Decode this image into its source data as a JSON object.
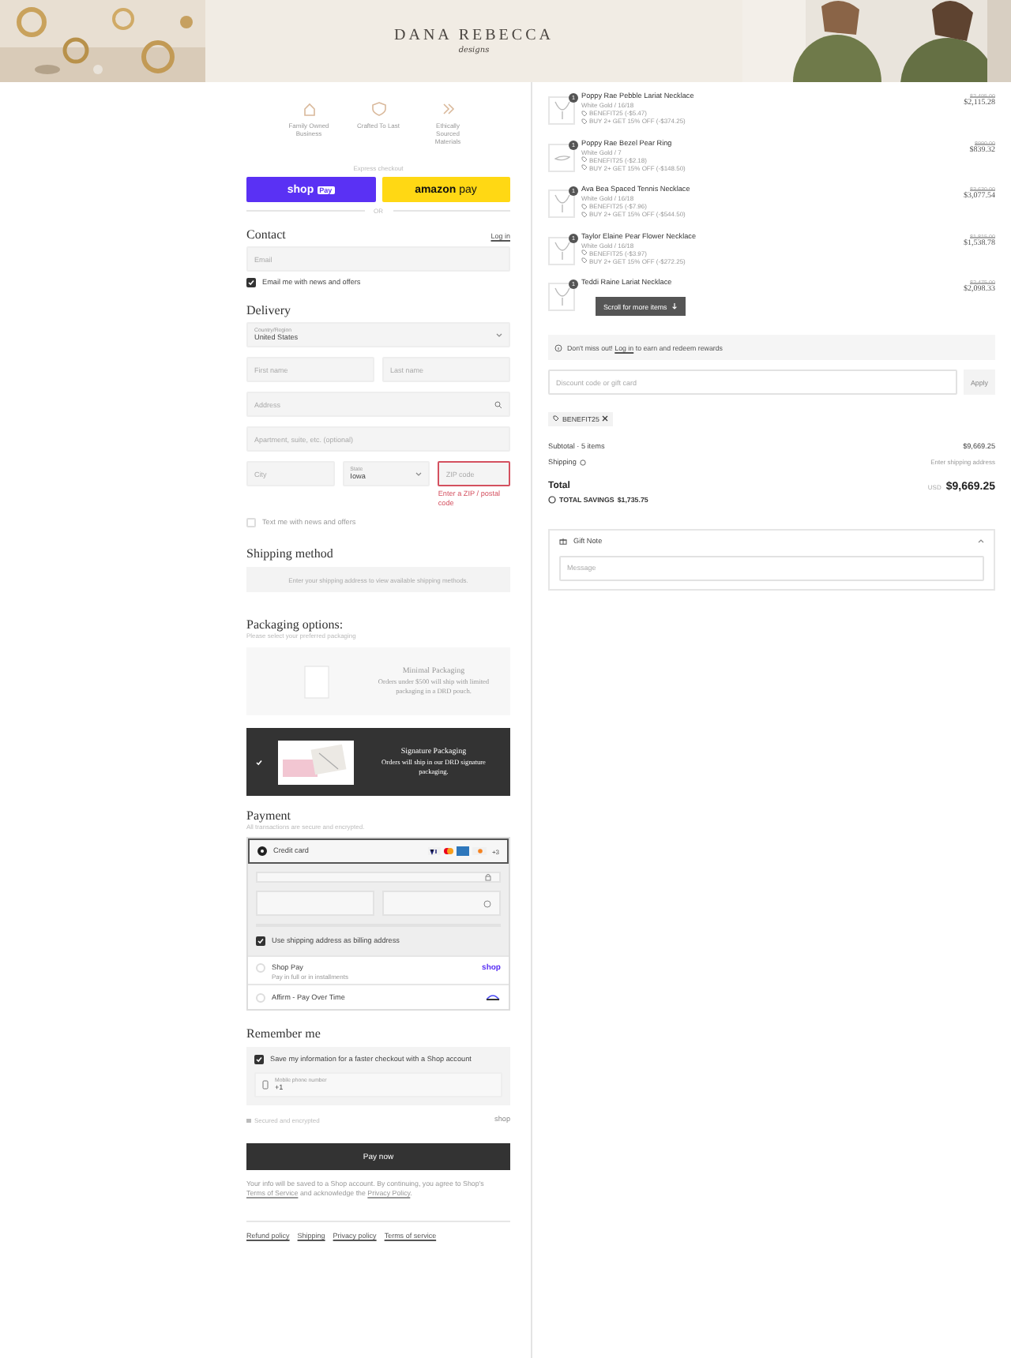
{
  "header": {
    "logo": "DANA REBECCA",
    "logo_sub": "designs"
  },
  "trust": [
    {
      "label": "Family Owned Business"
    },
    {
      "label": "Crafted To Last"
    },
    {
      "label": "Ethically Sourced Materials"
    }
  ],
  "express": {
    "label": "Express checkout",
    "buttons": [
      {
        "kind": "shop",
        "text": "shop",
        "badge": "Pay"
      },
      {
        "kind": "amazon",
        "text": "amazon",
        "suffix": "pay"
      }
    ],
    "or": "OR"
  },
  "contact": {
    "title": "Contact",
    "login": "Log in",
    "email": {
      "placeholder": "Email"
    },
    "news": {
      "label": "Email me with news and offers",
      "checked": true
    }
  },
  "delivery": {
    "title": "Delivery",
    "country": {
      "label": "Country/Region",
      "value": "United States"
    },
    "first_name": {
      "placeholder": "First name"
    },
    "last_name": {
      "placeholder": "Last name"
    },
    "address": {
      "placeholder": "Address"
    },
    "apartment": {
      "placeholder": "Apartment, suite, etc. (optional)"
    },
    "city": {
      "placeholder": "City"
    },
    "state": {
      "label": "State",
      "value": "Iowa"
    },
    "zip": {
      "placeholder": "ZIP code",
      "error": "Enter a ZIP / postal code"
    },
    "sms": {
      "label": "Text me with news and offers",
      "checked": false
    }
  },
  "shipping": {
    "title": "Shipping method",
    "notice": "Enter your shipping address to view available shipping methods."
  },
  "packaging": {
    "title": "Packaging options:",
    "subtitle": "Please select your preferred packaging",
    "options": [
      {
        "kind": "minimal",
        "name": "Minimal Packaging",
        "desc": "Orders under $500 will ship with limited packaging in a DRD pouch.",
        "selected": false
      },
      {
        "kind": "signature",
        "name": "Signature Packaging",
        "desc": "Orders will ship in our DRD signature packaging.",
        "selected": true
      }
    ]
  },
  "payment": {
    "title": "Payment",
    "subtitle": "All transactions are secure and encrypted.",
    "methods": [
      {
        "kind": "card",
        "label": "Credit card",
        "more": "+3",
        "selected": true
      },
      {
        "kind": "shop",
        "label": "Shop Pay",
        "sub": "Pay in full or in installments",
        "logo": "shop",
        "selected": false
      },
      {
        "kind": "affirm",
        "label": "Affirm - Pay Over Time",
        "selected": false
      }
    ],
    "billing": {
      "label": "Use shipping address as billing address",
      "checked": true
    }
  },
  "remember": {
    "title": "Remember me",
    "save": {
      "label": "Save my information for a faster checkout with a Shop account",
      "checked": true
    },
    "phone": {
      "label": "Mobile phone number",
      "value": "+1"
    },
    "secure": "Secured and encrypted",
    "shop": "shop"
  },
  "pay_button": "Pay now",
  "disclaimer": {
    "before": "Your info will be saved to a Shop account. By continuing, you agree to Shop's",
    "terms": "Terms of Service",
    "middle": "and acknowledge the",
    "privacy": "Privacy Policy",
    "after": "."
  },
  "footer": [
    "Refund policy",
    "Shipping",
    "Privacy policy",
    "Terms of service"
  ],
  "items": [
    {
      "name": "Poppy Rae Pebble Lariat Necklace",
      "qty": "1",
      "variant": "White Gold / 16/18",
      "discounts": [
        "BENEFIT25 (-$5.47)",
        "BUY 2+ GET 15% OFF (-$374.25)"
      ],
      "was": "$2,495.00",
      "price": "$2,115.28"
    },
    {
      "name": "Poppy Rae Bezel Pear Ring",
      "qty": "1",
      "variant": "White Gold / 7",
      "discounts": [
        "BENEFIT25 (-$2.18)",
        "BUY 2+ GET 15% OFF (-$148.50)"
      ],
      "was": "$990.00",
      "price": "$839.32"
    },
    {
      "name": "Ava Bea Spaced Tennis Necklace",
      "qty": "1",
      "variant": "White Gold / 16/18",
      "discounts": [
        "BENEFIT25 (-$7.96)",
        "BUY 2+ GET 15% OFF (-$544.50)"
      ],
      "was": "$3,630.00",
      "price": "$3,077.54"
    },
    {
      "name": "Taylor Elaine Pear Flower Necklace",
      "qty": "1",
      "variant": "White Gold / 16/18",
      "discounts": [
        "BENEFIT25 (-$3.97)",
        "BUY 2+ GET 15% OFF (-$272.25)"
      ],
      "was": "$1,815.00",
      "price": "$1,538.78"
    },
    {
      "name": "Teddi Raine Lariat Necklace",
      "qty": "1",
      "was": "$2,475.00",
      "price": "$2,098.33"
    }
  ],
  "scroll_hint": "Scroll for more items",
  "rewards": {
    "before": "Don't miss out!",
    "link": "Log in",
    "after": "to earn and redeem rewards"
  },
  "discount": {
    "placeholder": "Discount code or gift card",
    "button": "Apply",
    "applied": "BENEFIT25"
  },
  "subtotal": {
    "label": "Subtotal · 5 items",
    "value": "$9,669.25"
  },
  "shipping_line": {
    "label": "Shipping",
    "value": "Enter shipping address"
  },
  "total": {
    "label": "Total",
    "currency": "USD",
    "value": "$9,669.25"
  },
  "savings": {
    "label": "TOTAL SAVINGS",
    "value": "$1,735.75"
  },
  "gift_note": {
    "title": "Gift Note",
    "expanded": true,
    "placeholder": "Message"
  }
}
